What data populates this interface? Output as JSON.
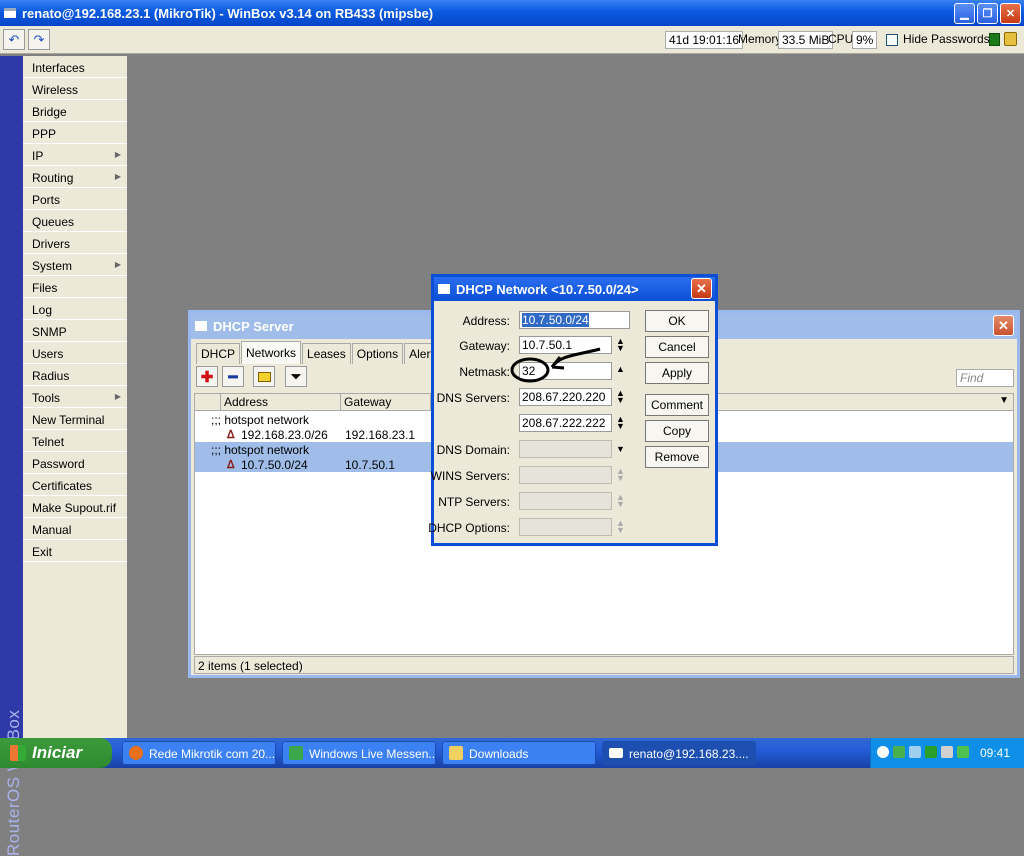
{
  "window": {
    "title": "renato@192.168.23.1 (MikroTik) - WinBox v3.14 on RB433 (mipsbe)"
  },
  "toolbar": {
    "uptime": "41d 19:01:16",
    "memory_label": "Memory:",
    "memory_value": "33.5 MiB",
    "cpu_label": "CPU:",
    "cpu_value": "9%",
    "hide_passwords": "Hide Passwords"
  },
  "sidebar": {
    "brand": "RouterOS WinBox",
    "items": [
      {
        "label": "Interfaces",
        "submenu": false
      },
      {
        "label": "Wireless",
        "submenu": false
      },
      {
        "label": "Bridge",
        "submenu": false
      },
      {
        "label": "PPP",
        "submenu": false
      },
      {
        "label": "IP",
        "submenu": true
      },
      {
        "label": "Routing",
        "submenu": true
      },
      {
        "label": "Ports",
        "submenu": false
      },
      {
        "label": "Queues",
        "submenu": false
      },
      {
        "label": "Drivers",
        "submenu": false
      },
      {
        "label": "System",
        "submenu": true
      },
      {
        "label": "Files",
        "submenu": false
      },
      {
        "label": "Log",
        "submenu": false
      },
      {
        "label": "SNMP",
        "submenu": false
      },
      {
        "label": "Users",
        "submenu": false
      },
      {
        "label": "Radius",
        "submenu": false
      },
      {
        "label": "Tools",
        "submenu": true
      },
      {
        "label": "New Terminal",
        "submenu": false
      },
      {
        "label": "Telnet",
        "submenu": false
      },
      {
        "label": "Password",
        "submenu": false
      },
      {
        "label": "Certificates",
        "submenu": false
      },
      {
        "label": "Make Supout.rif",
        "submenu": false
      },
      {
        "label": "Manual",
        "submenu": false
      },
      {
        "label": "Exit",
        "submenu": false
      }
    ]
  },
  "dhcp_server": {
    "title": "DHCP Server",
    "tabs": [
      "DHCP",
      "Networks",
      "Leases",
      "Options",
      "Alerts"
    ],
    "active_tab": "Networks",
    "find_placeholder": "Find",
    "columns": [
      "Address",
      "Gateway"
    ],
    "rows": [
      {
        "comment": ";;; hotspot network",
        "address": "192.168.23.0/26",
        "gateway": "192.168.23.1",
        "selected": false
      },
      {
        "comment": ";;; hotspot network",
        "address": "10.7.50.0/24",
        "gateway": "10.7.50.1",
        "selected": true
      }
    ],
    "status": "2 items (1 selected)"
  },
  "dialog": {
    "title": "DHCP Network <10.7.50.0/24>",
    "labels": {
      "address": "Address:",
      "gateway": "Gateway:",
      "netmask": "Netmask:",
      "dns_servers": "DNS Servers:",
      "dns_domain": "DNS Domain:",
      "wins_servers": "WINS Servers:",
      "ntp_servers": "NTP Servers:",
      "dhcp_options": "DHCP Options:"
    },
    "values": {
      "address": "10.7.50.0/24",
      "gateway": "10.7.50.1",
      "netmask": "32",
      "dns1": "208.67.220.220",
      "dns2": "208.67.222.222",
      "dns_domain": "",
      "wins_servers": "",
      "ntp_servers": "",
      "dhcp_options": ""
    },
    "buttons": {
      "ok": "OK",
      "cancel": "Cancel",
      "apply": "Apply",
      "comment": "Comment",
      "copy": "Copy",
      "remove": "Remove"
    }
  },
  "taskbar": {
    "start": "Iniciar",
    "tasks": [
      {
        "label": "Rede Mikrotik com 20...",
        "icon": "firefox-icon"
      },
      {
        "label": "Windows Live Messen...",
        "icon": "messenger-icon"
      },
      {
        "label": "Downloads",
        "icon": "folder-icon"
      },
      {
        "label": "renato@192.168.23....",
        "icon": "winbox-icon"
      }
    ],
    "clock": "09:41"
  },
  "colors": {
    "selection": "#9fbde8",
    "titlebar": "#0a4fd6",
    "sidebar_stripe": "#2f3aa8"
  }
}
